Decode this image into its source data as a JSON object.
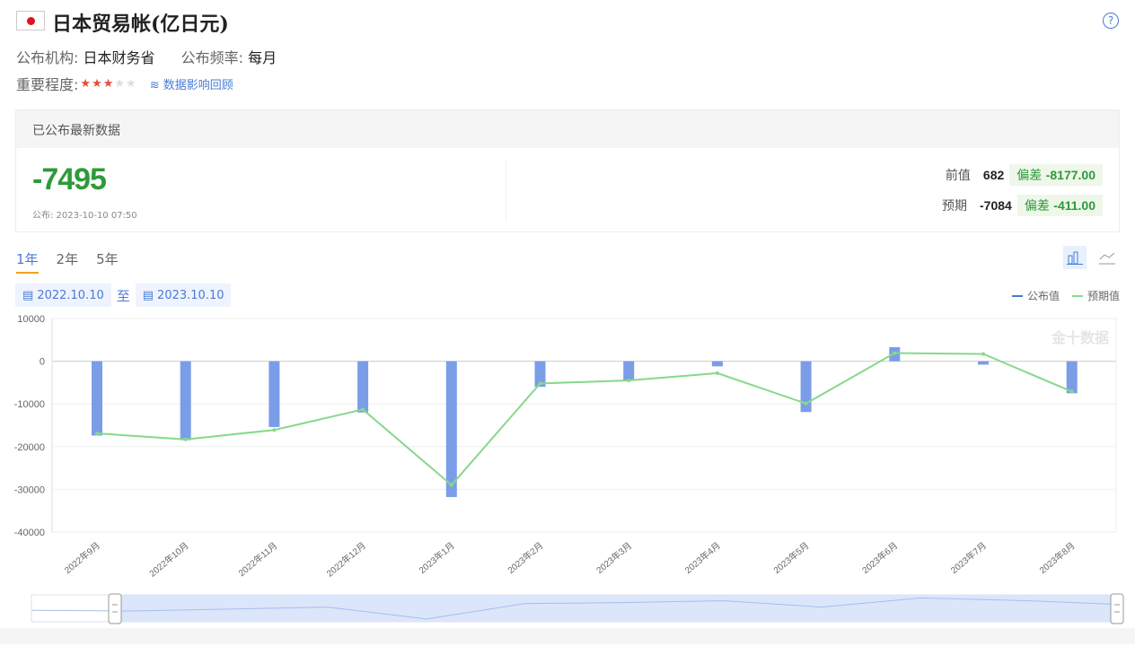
{
  "header": {
    "title": "日本贸易帐(亿日元)",
    "help": "?"
  },
  "meta": {
    "publisher_label": "公布机构:",
    "publisher": "日本财务省",
    "frequency_label": "公布频率:",
    "frequency": "每月",
    "importance_label": "重要程度:",
    "importance_stars": 3,
    "importance_max": 5,
    "impact_link": "数据影响回顾"
  },
  "latest": {
    "heading": "已公布最新数据",
    "actual": "-7495",
    "publish_time": "公布: 2023-10-10 07:50",
    "previous_label": "前值",
    "previous": "682",
    "previous_dev_label": "偏差",
    "previous_dev": "-8177.00",
    "forecast_label": "预期",
    "forecast": "-7084",
    "forecast_dev_label": "偏差",
    "forecast_dev": "-411.00"
  },
  "tabs": [
    "1年",
    "2年",
    "5年"
  ],
  "range": {
    "start": "2022.10.10",
    "sep": "至",
    "end": "2023.10.10"
  },
  "legend": {
    "actual": "公布值",
    "forecast": "预期值"
  },
  "watermark": "金十数据",
  "colors": {
    "actual": "#7b9de8",
    "forecast": "#86d98a",
    "accent": "#4a7bd6",
    "positive": "#2e9a3a"
  },
  "chart_data": {
    "type": "bar",
    "categories": [
      "2022年9月",
      "2022年10月",
      "2022年11月",
      "2022年12月",
      "2023年1月",
      "2023年2月",
      "2023年3月",
      "2023年4月",
      "2023年5月",
      "2023年6月",
      "2023年7月",
      "2023年8月"
    ],
    "series": [
      {
        "name": "公布值",
        "type": "bar",
        "values": [
          -17400,
          -18500,
          -15400,
          -12000,
          -31800,
          -6000,
          -4500,
          -1200,
          -11900,
          3300,
          -800,
          -7500
        ]
      },
      {
        "name": "预期值",
        "type": "line",
        "values": [
          -16900,
          -18300,
          -16100,
          -11300,
          -29000,
          -5200,
          -4500,
          -2800,
          -9900,
          1900,
          1700,
          -7100
        ]
      }
    ],
    "ylim": [
      -40000,
      10000
    ],
    "yticks": [
      10000,
      0,
      -10000,
      -20000,
      -30000,
      -40000
    ],
    "grid": true,
    "legend_position": "top-right"
  }
}
